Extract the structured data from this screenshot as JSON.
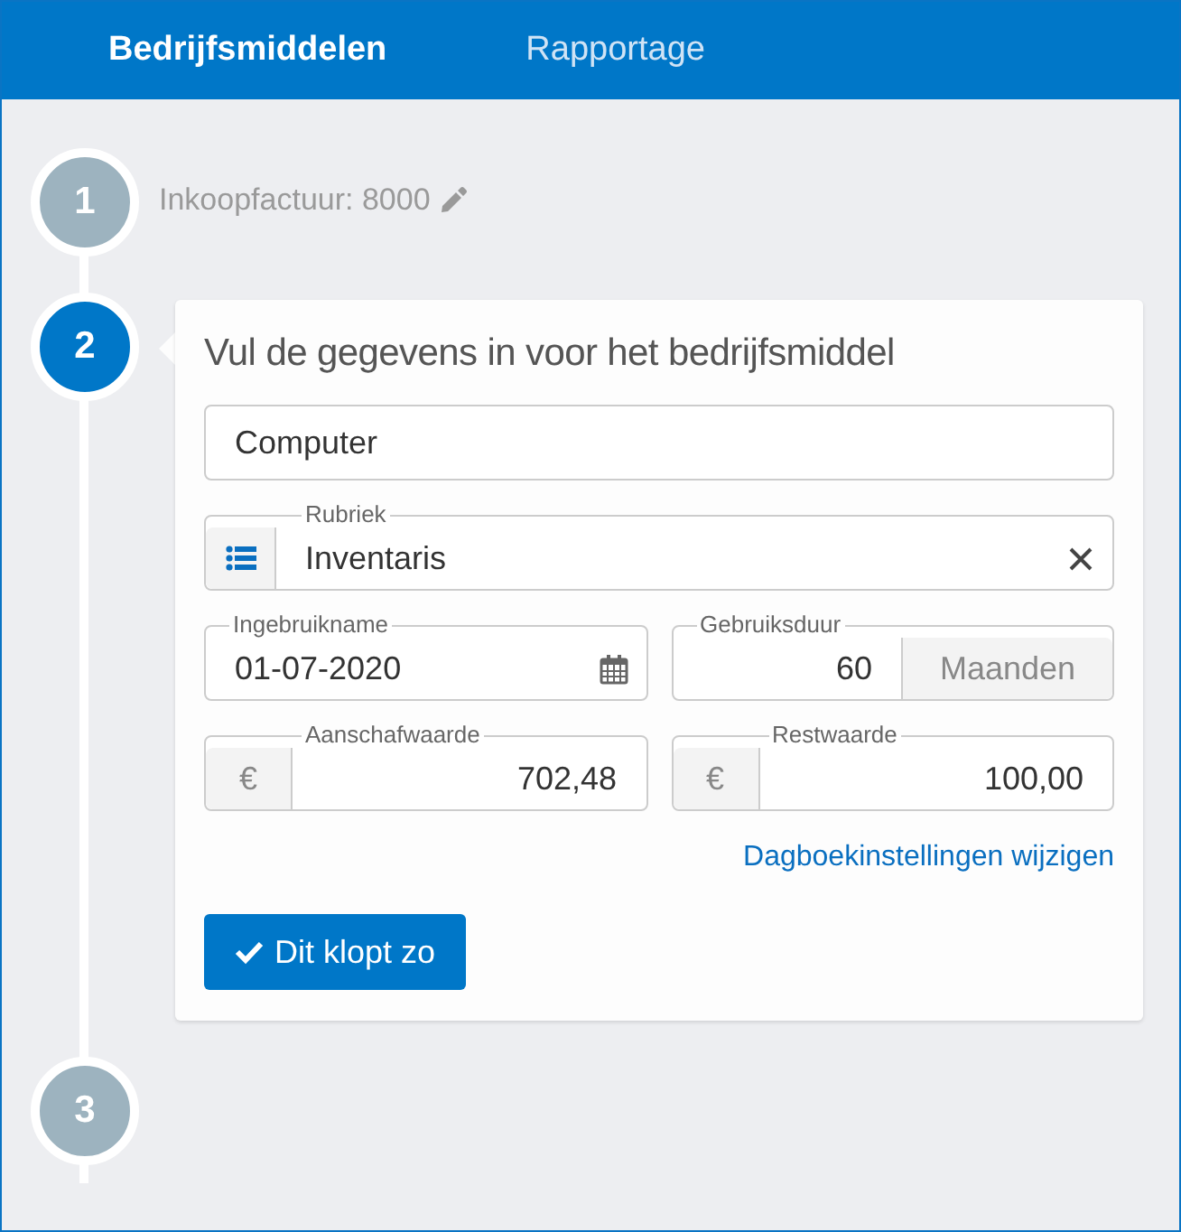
{
  "tabs": [
    {
      "label": "Bedrijfsmiddelen",
      "selected": true
    },
    {
      "label": "Rapportage",
      "selected": false
    }
  ],
  "steps": [
    {
      "number": "1",
      "kind": "summary",
      "selected": false,
      "text": "Inkoopfactuur: 8000"
    },
    {
      "number": "2",
      "kind": "form",
      "selected": true,
      "title": "Vul de gegevens in voor het bedrijfsmiddel",
      "rows": [
        [
          {
            "kind": "text",
            "value": "Computer"
          }
        ],
        [
          {
            "kind": "select",
            "label": "Rubriek",
            "value": "Inventaris"
          }
        ],
        [
          {
            "kind": "date",
            "label": "Ingebruikname",
            "value": "01-07-2020"
          },
          {
            "kind": "unit",
            "label": "Gebruiksduur",
            "value": "60",
            "unit": "Maanden"
          }
        ],
        [
          {
            "kind": "currency",
            "label": "Aanschafwaarde",
            "symbol": "€",
            "value": "702,48"
          },
          {
            "kind": "currency",
            "label": "Restwaarde",
            "symbol": "€",
            "value": "100,00"
          }
        ]
      ],
      "link": "Dagboekinstellingen wijzigen",
      "button": "Dit klopt zo"
    },
    {
      "number": "3",
      "kind": "pending",
      "selected": false
    }
  ]
}
